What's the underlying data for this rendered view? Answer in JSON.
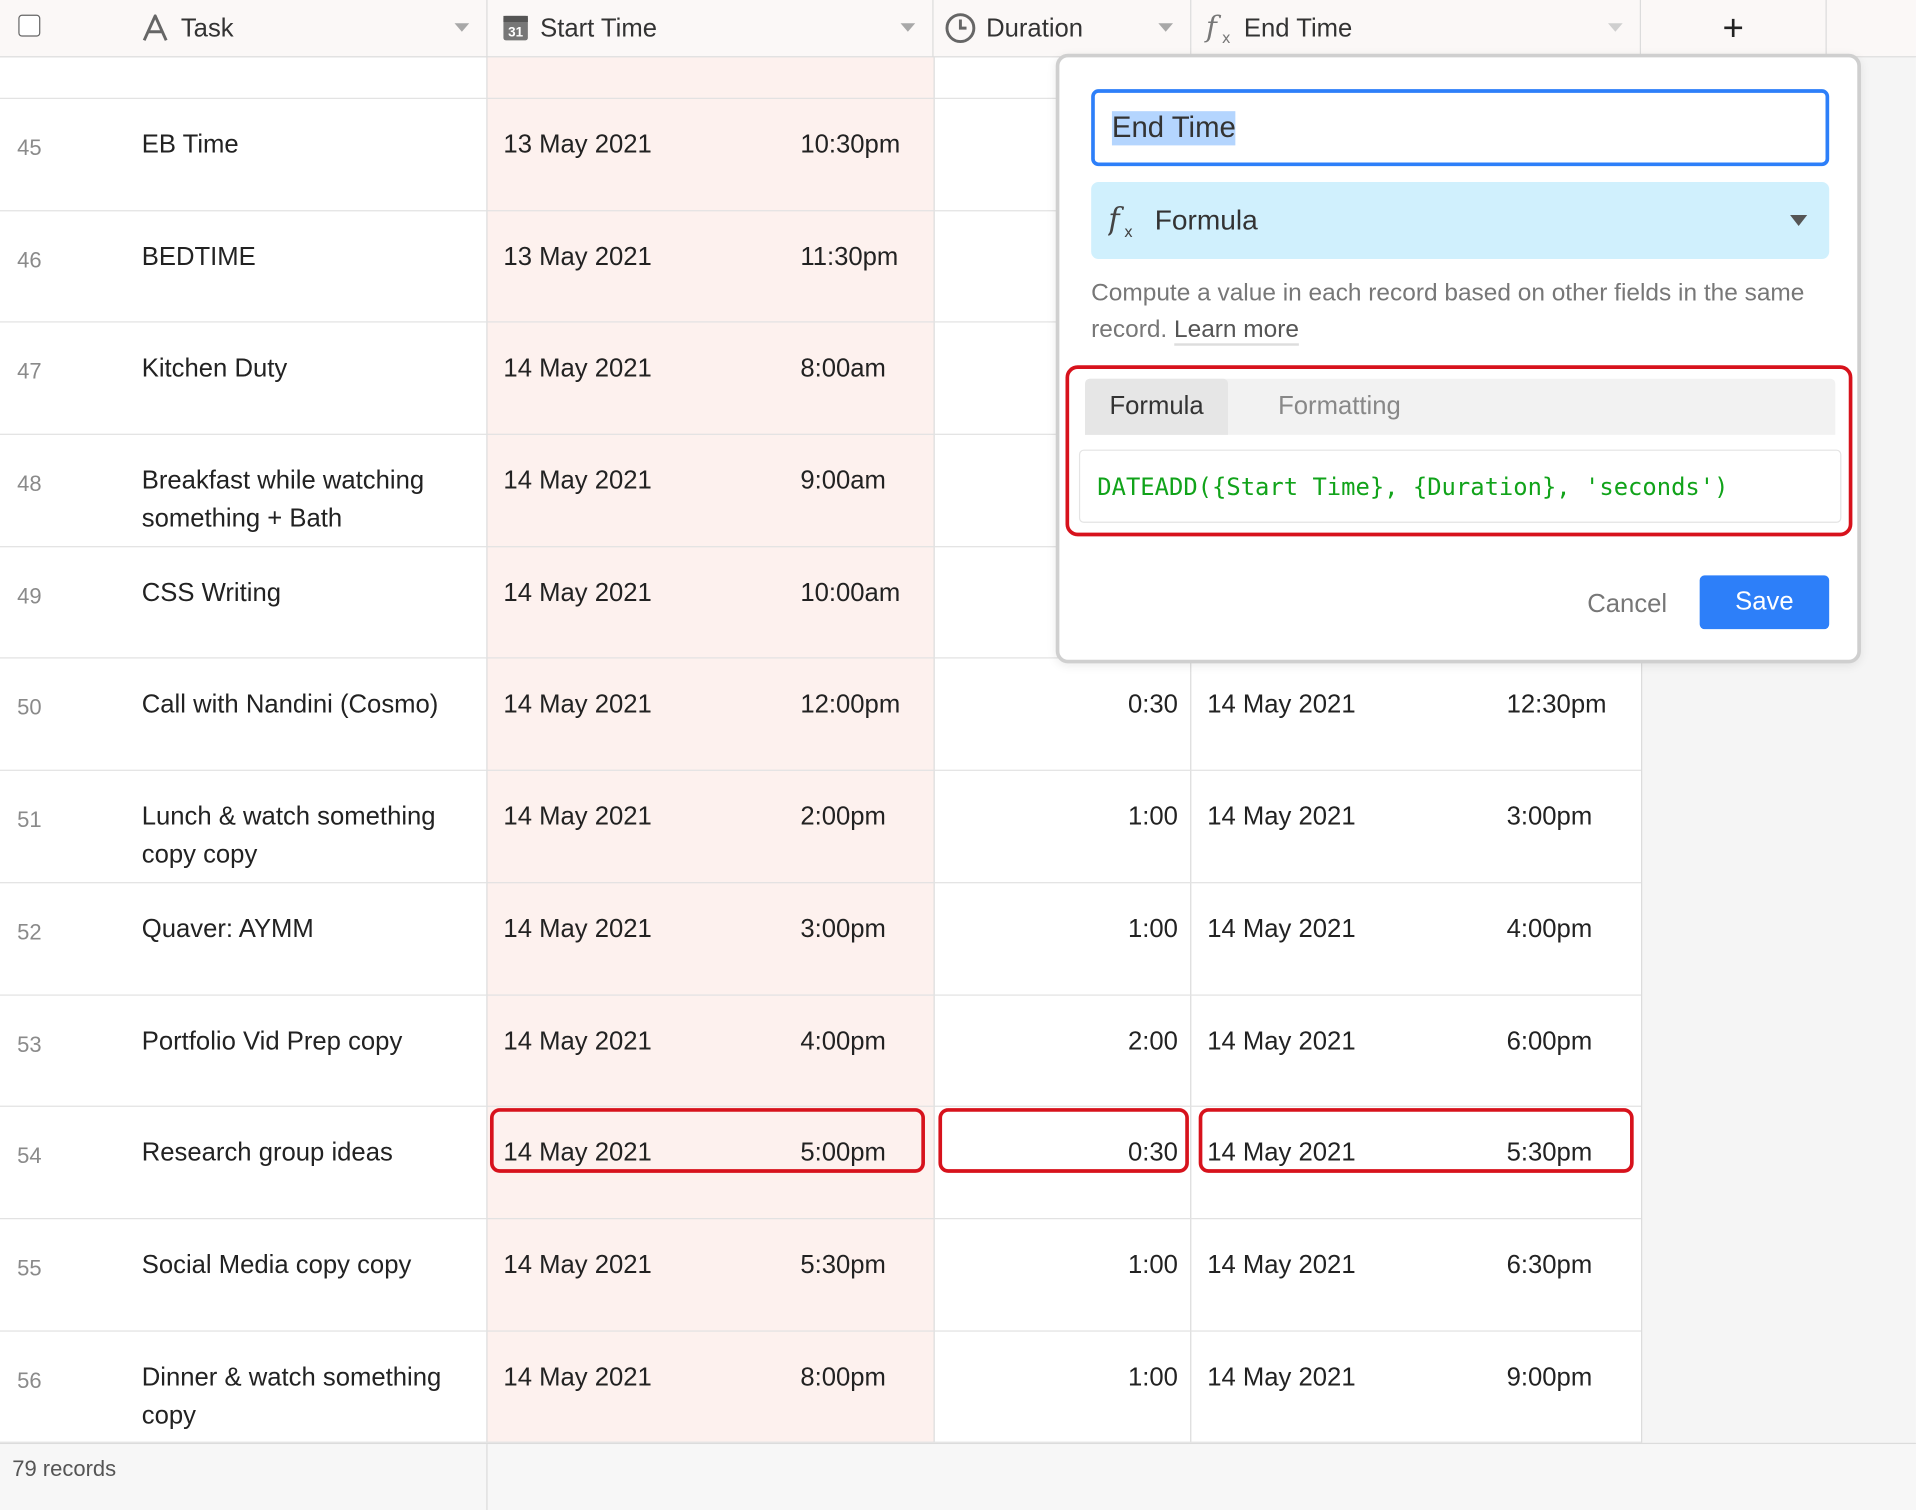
{
  "header": {
    "task": "Task",
    "start": "Start Time",
    "start_icon_text": "31",
    "duration": "Duration",
    "end": "End Time",
    "add_symbol": "+"
  },
  "rows": [
    {
      "num": "45",
      "task": "EB Time",
      "sdate": "13 May 2021",
      "stime": "10:30pm",
      "dur": "",
      "edate": "",
      "etime": ""
    },
    {
      "num": "46",
      "task": "BEDTIME",
      "sdate": "13 May 2021",
      "stime": "11:30pm",
      "dur": "",
      "edate": "",
      "etime": ""
    },
    {
      "num": "47",
      "task": "Kitchen Duty",
      "sdate": "14 May 2021",
      "stime": "8:00am",
      "dur": "",
      "edate": "",
      "etime": ""
    },
    {
      "num": "48",
      "task": "Breakfast while watching something + Bath",
      "sdate": "14 May 2021",
      "stime": "9:00am",
      "dur": "",
      "edate": "",
      "etime": ""
    },
    {
      "num": "49",
      "task": "CSS Writing",
      "sdate": "14 May 2021",
      "stime": "10:00am",
      "dur": "",
      "edate": "",
      "etime": ""
    },
    {
      "num": "50",
      "task": "Call with Nandini (Cosmo)",
      "sdate": "14 May 2021",
      "stime": "12:00pm",
      "dur": "0:30",
      "edate": "14 May 2021",
      "etime": "12:30pm"
    },
    {
      "num": "51",
      "task": "Lunch & watch something copy copy",
      "sdate": "14 May 2021",
      "stime": "2:00pm",
      "dur": "1:00",
      "edate": "14 May 2021",
      "etime": "3:00pm"
    },
    {
      "num": "52",
      "task": "Quaver: AYMM",
      "sdate": "14 May 2021",
      "stime": "3:00pm",
      "dur": "1:00",
      "edate": "14 May 2021",
      "etime": "4:00pm"
    },
    {
      "num": "53",
      "task": "Portfolio Vid Prep copy",
      "sdate": "14 May 2021",
      "stime": "4:00pm",
      "dur": "2:00",
      "edate": "14 May 2021",
      "etime": "6:00pm"
    },
    {
      "num": "54",
      "task": "Research group ideas",
      "sdate": "14 May 2021",
      "stime": "5:00pm",
      "dur": "0:30",
      "edate": "14 May 2021",
      "etime": "5:30pm"
    },
    {
      "num": "55",
      "task": "Social Media copy copy",
      "sdate": "14 May 2021",
      "stime": "5:30pm",
      "dur": "1:00",
      "edate": "14 May 2021",
      "etime": "6:30pm"
    },
    {
      "num": "56",
      "task": "Dinner & watch something copy",
      "sdate": "14 May 2021",
      "stime": "8:00pm",
      "dur": "1:00",
      "edate": "14 May 2021",
      "etime": "9:00pm"
    }
  ],
  "footer": {
    "count": "79 records"
  },
  "popup": {
    "field_name": "End Time",
    "type_label": "Formula",
    "description": "Compute a value in each record based on other fields in the same record.",
    "learn_more": "Learn more",
    "tab_formula": "Formula",
    "tab_formatting": "Formatting",
    "formula": "DATEADD({Start Time}, {Duration}, 'seconds')",
    "cancel": "Cancel",
    "save": "Save"
  },
  "colors": {
    "accent": "#2d7ff9",
    "highlight": "#d7121c",
    "start_column_bg": "#fdf1ee",
    "type_select_bg": "#d0f0fd",
    "formula_text": "#11a31a"
  },
  "icons": {
    "task": "text-field-icon",
    "start": "calendar-icon",
    "duration": "clock-icon",
    "end": "formula-icon",
    "add": "plus-icon"
  }
}
